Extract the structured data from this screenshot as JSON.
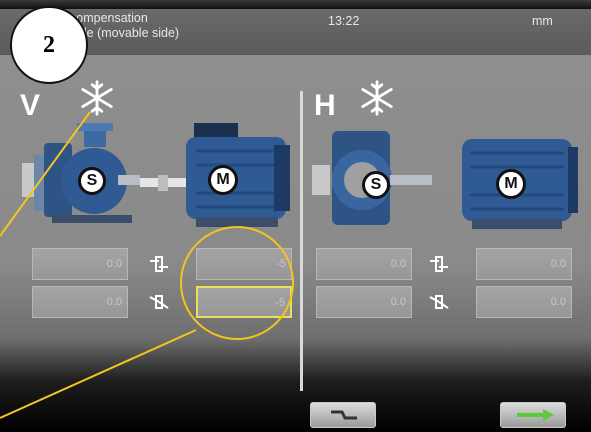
{
  "header": {
    "title_line1": "compensation",
    "title_line2": "ngle (movable side)",
    "clock": "13:22",
    "units": "mm"
  },
  "step_badge": "2",
  "left_panel": {
    "axis_label": "V",
    "stationary_label": "S",
    "movable_label": "M",
    "rows": [
      {
        "stationary_value": "0.0",
        "movable_value": "-5"
      },
      {
        "stationary_value": "0.0",
        "movable_value": "-5"
      }
    ]
  },
  "right_panel": {
    "axis_label": "H",
    "stationary_label": "S",
    "movable_label": "M",
    "rows": [
      {
        "stationary_value": "0.0",
        "movable_value": "0.0"
      },
      {
        "stationary_value": "0.0",
        "movable_value": "0.0"
      }
    ]
  },
  "icons": {
    "thermal": "snowflake-icon",
    "offset": "offset-icon",
    "angle": "angle-icon",
    "shaft": "shaft-icon",
    "next": "arrow-right-icon"
  },
  "colors": {
    "motor_blue": "#2f5a93",
    "annotation": "#f2c51c",
    "selection": "#e8e05a",
    "next_arrow": "#5ccb3a"
  }
}
